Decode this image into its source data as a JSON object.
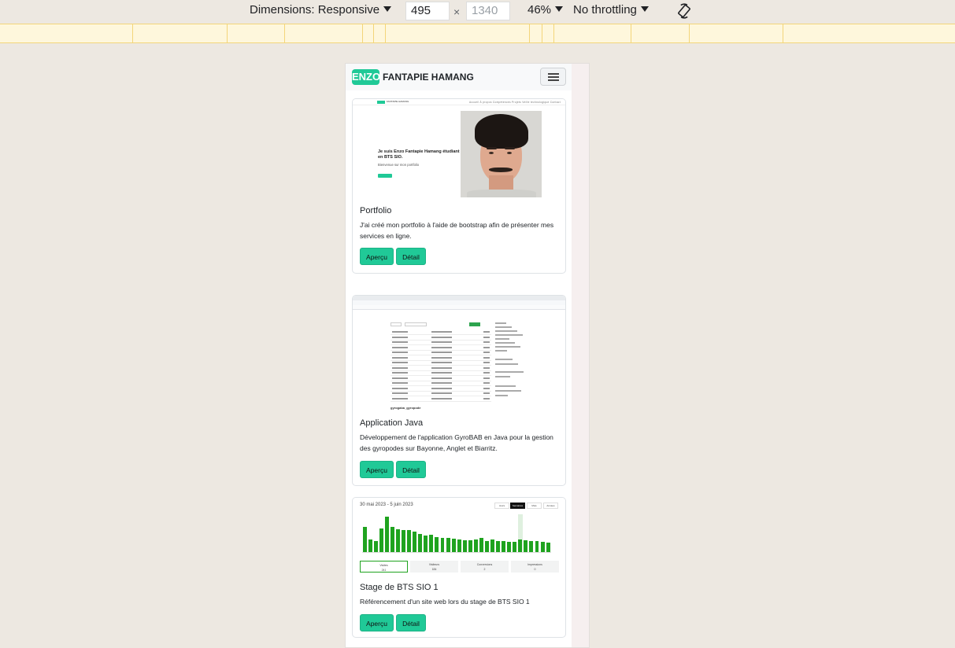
{
  "devtools": {
    "dimensions_label": "Dimensions: Responsive",
    "width_value": "495",
    "height_placeholder": "1340",
    "times": "×",
    "zoom": "46%",
    "throttling": "No throttling"
  },
  "site": {
    "brand_badge": "ENZO",
    "brand_name": "FANTAPIE HAMANG"
  },
  "cards": [
    {
      "title": "Portfolio",
      "text": "J'ai créé mon portfolio à l'aide de bootstrap afin de présenter mes services en ligne.",
      "preview_label": "Aperçu",
      "detail_label": "Détail",
      "thumb": {
        "nav_logo": "ENZO",
        "nav_name": "FANTAPIE HAMANG",
        "nav_links": "Accueil  À propos  Compétences  Projets  Veille technologique  Contact",
        "headline": "Je suis Enzo Fantapie Hamang étudiant en BTS SIO.",
        "subline": "Bienvenue sur mon portfolio"
      }
    },
    {
      "title": "Application Java",
      "text": "Développement de l'application GyroBAB en Java pour la gestion des gyropodes sur Bayonne, Anglet et Biarritz.",
      "preview_label": "Aperçu",
      "detail_label": "Détail",
      "thumb": {
        "repo_caption": "gyrogaba_gyropode"
      }
    },
    {
      "title": "Stage de BTS SIO 1",
      "text": "Référencement d'un site web lors du stage de BTS SIO 1",
      "preview_label": "Aperçu",
      "detail_label": "Détail",
      "thumb": {
        "date_range": "30 mai 2023 - 5 juin 2023",
        "tabs": [
          "Jours",
          "Semaines",
          "Mois",
          "Années"
        ],
        "stats": [
          {
            "label": "Visites",
            "value": "241"
          },
          {
            "label": "Visiteurs",
            "value": "184"
          },
          {
            "label": "Conversions",
            "value": "2"
          },
          {
            "label": "Impressions",
            "value": "0"
          }
        ],
        "bar_values": [
          40,
          20,
          18,
          37,
          56,
          40,
          36,
          35,
          35,
          33,
          29,
          26,
          27,
          24,
          22,
          22,
          21,
          20,
          19,
          19,
          20,
          22,
          18,
          20,
          18,
          18,
          16,
          16,
          20,
          19,
          17,
          17,
          16,
          15
        ],
        "highlight_index": 28
      }
    }
  ]
}
